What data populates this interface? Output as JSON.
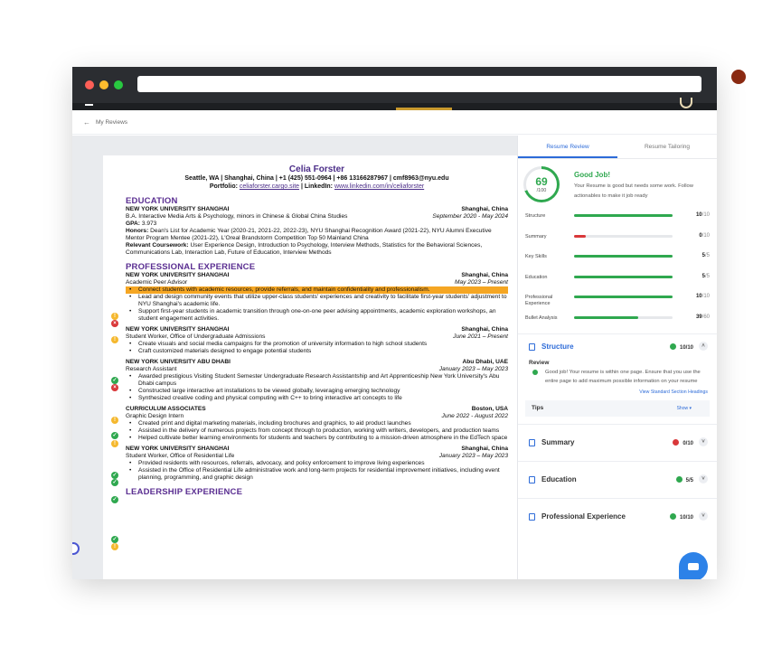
{
  "breadcrumb": {
    "back_label": "My Reviews"
  },
  "resume": {
    "name": "Celia Forster",
    "contact_line": "Seattle, WA | Shanghai, China | +1 (425) 551-0964 | +86 13166287967 | cmf8963@nyu.edu",
    "portfolio_label": "Portfolio:",
    "portfolio_link": "celiaforster.cargo.site",
    "linkedin_label": "| LinkedIn:",
    "linkedin_link": "www.linkedin.com/in/celiaforster",
    "education_heading": "EDUCATION",
    "edu": {
      "school": "NEW YORK UNIVERSITY SHANGHAI",
      "location": "Shanghai, China",
      "degree": "B.A. Interactive Media Arts & Psychology, minors in Chinese & Global China Studies",
      "dates": "September 2020 - May 2024",
      "gpa_label": "GPA:",
      "gpa": "3.973",
      "honors_label": "Honors:",
      "honors": "Dean's List for Academic Year (2020-21, 2021-22, 2022-23), NYU Shanghai Recognition Award (2021-22), NYU Alumni Executive Mentor Program Mentee (2021-22), L'Oreal Brandstorm Competition Top 50 Mainland China",
      "coursework_label": "Relevant Coursework:",
      "coursework": "User Experience Design, Introduction to Psychology, Interview Methods, Statistics for the Behavioral Sciences, Communications Lab, Interaction Lab, Future of Education, Interview Methods"
    },
    "experience_heading": "PROFESSIONAL EXPERIENCE",
    "jobs": [
      {
        "org": "NEW YORK UNIVERSITY SHANGHAI",
        "location": "Shanghai, China",
        "role": "Academic Peer Advisor",
        "dates": "May 2023 – Present",
        "bullets": [
          "Connect students with academic resources, provide referrals, and maintain confidentiality and professionalism.",
          "Lead and design community events that utilize upper-class students' experiences and creativity to facilitate first-year students' adjustment to NYU Shanghai's academic life.",
          "Support first-year students in academic transition through one-on-one peer advising appointments, academic exploration workshops, an student engagement activities."
        ]
      },
      {
        "org": "NEW YORK UNIVERSITY SHANGHAI",
        "location": "Shanghai, China",
        "role": "Student Worker, Office of Undergraduate Admissions",
        "dates": "June 2021 – Present",
        "bullets": [
          "Create visuals and social media campaigns for the promotion of university information to high school students",
          "Craft customized materials designed to engage potential students"
        ]
      },
      {
        "org": "NEW YORK UNIVERSITY ABU DHABI",
        "location": "Abu Dhabi, UAE",
        "role": "Research Assistant",
        "dates": "January 2023 – May 2023",
        "bullets": [
          "Awarded prestigious Visiting Student Semester Undergraduate Research Assistantship and Art Apprenticeship New York University's Abu Dhabi campus",
          "Constructed large interactive art installations to be viewed globally, leveraging emerging technology",
          "Synthesized creative coding and physical computing with C++ to bring interactive art concepts to life"
        ]
      },
      {
        "org": "CURRICULUM ASSOCIATES",
        "location": "Boston, USA",
        "role": "Graphic Design Intern",
        "dates": "June 2022 - August 2022",
        "bullets": [
          "Created print and digital marketing materials, including brochures and graphics, to aid product launches",
          "Assisted in the delivery of numerous projects from concept through to production, working with writers, developers, and production teams",
          "Helped cultivate better learning environments for students and teachers by contributing to a mission-driven atmosphere in the EdTech space"
        ]
      },
      {
        "org": "NEW YORK UNIVERSITY SHANGHAI",
        "location": "Shanghai, China",
        "role": "Student Worker, Office of Residential Life",
        "dates": "January 2023 – May 2023",
        "bullets": [
          "Provided residents with resources, referrals, advocacy, and policy enforcement to improve living experiences",
          "Assisted in the Office of Residential Life administrative work and long-term projects for residential improvement initiatives, including event planning, programming, and graphic design"
        ]
      }
    ],
    "leadership_heading": "LEADERSHIP EXPERIENCE"
  },
  "sidebar": {
    "tabs": [
      "Resume Review",
      "Resume Tailoring"
    ],
    "score": "69",
    "score_total": "/100",
    "headline": "Good Job!",
    "message": "Your Resume is good but needs some work. Follow actionables to make it job ready",
    "metrics": [
      {
        "label": "Structure",
        "score": "10",
        "total": "/10",
        "pct": 1.0,
        "color": "#2fa84f"
      },
      {
        "label": "Summary",
        "score": "0",
        "total": "/10",
        "pct": 0.12,
        "color": "#d9383a"
      },
      {
        "label": "Key Skills",
        "score": "5",
        "total": "/5",
        "pct": 1.0,
        "color": "#2fa84f"
      },
      {
        "label": "Education",
        "score": "5",
        "total": "/5",
        "pct": 1.0,
        "color": "#2fa84f"
      },
      {
        "label": "Professional Experience",
        "score": "10",
        "total": "/10",
        "pct": 1.0,
        "color": "#2fa84f"
      },
      {
        "label": "Bullet Analysis",
        "score": "39",
        "total": "/60",
        "pct": 0.65,
        "color": "#2fa84f"
      }
    ],
    "structure_panel": {
      "title": "Structure",
      "score": "10/10",
      "review_label": "Review",
      "review_text": "Good job! Your resume is within one page. Ensure that you use the entire page to add maximum possible information on your resume",
      "link": "View Standard Section Headings",
      "tips_label": "Tips",
      "show_label": "Show ▾"
    },
    "panels": [
      {
        "title": "Summary",
        "score": "0/10",
        "status_color": "#d9383a"
      },
      {
        "title": "Education",
        "score": "5/5",
        "status_color": "#2fa84f"
      },
      {
        "title": "Professional Experience",
        "score": "10/10",
        "status_color": "#2fa84f"
      }
    ]
  }
}
